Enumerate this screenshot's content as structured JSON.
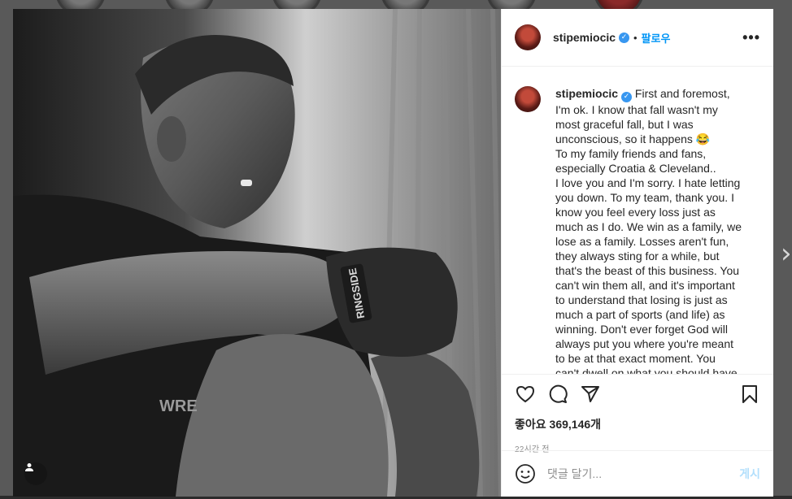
{
  "post": {
    "username": "stipemiocic",
    "dot": "•",
    "follow_label": "팔로우",
    "more_label": "•••",
    "caption_username": "stipemiocic",
    "caption_text": "First and foremost,\nI'm ok. I know that fall wasn't my\nmost graceful fall, but I was\nunconscious, so it happens 😂\nTo my family friends and fans,\nespecially Croatia & Cleveland..\nI love you and I'm sorry. I hate letting\nyou down. To my team, thank you. I\nknow you feel every loss just as\nmuch as I do. We win as a family, we\nlose as a family. Losses aren't fun,\nthey always sting for a while, but\nthat's the beast of this business. You\ncan't win them all, and it's important\nto understand that losing is just as\nmuch a part of sports (and life) as\nwinning. Don't ever forget God will\nalways put you where you're meant\nto be at that exact moment. You\ncan't dwell on what you should have",
    "likes_text": "좋아요 369,146개",
    "timestamp": "22시간 전",
    "comment_placeholder": "댓글 달기...",
    "post_button": "게시",
    "verified_mark": "✓",
    "next_arrow": "›"
  },
  "photo": {
    "wrap_text": "RINGSIDE",
    "shirt_text": "WRE"
  },
  "icons": {
    "like": "heart-icon",
    "comment": "comment-icon",
    "share": "paper-plane-icon",
    "save": "bookmark-icon",
    "emoji": "smiley-icon",
    "user_tag": "user-tag-icon",
    "more": "more-options-icon"
  },
  "colors": {
    "accent": "#0095f6",
    "verified": "#3897f0",
    "post_disabled": "#b2dffc",
    "text": "#262626",
    "muted": "#8e8e8e"
  }
}
